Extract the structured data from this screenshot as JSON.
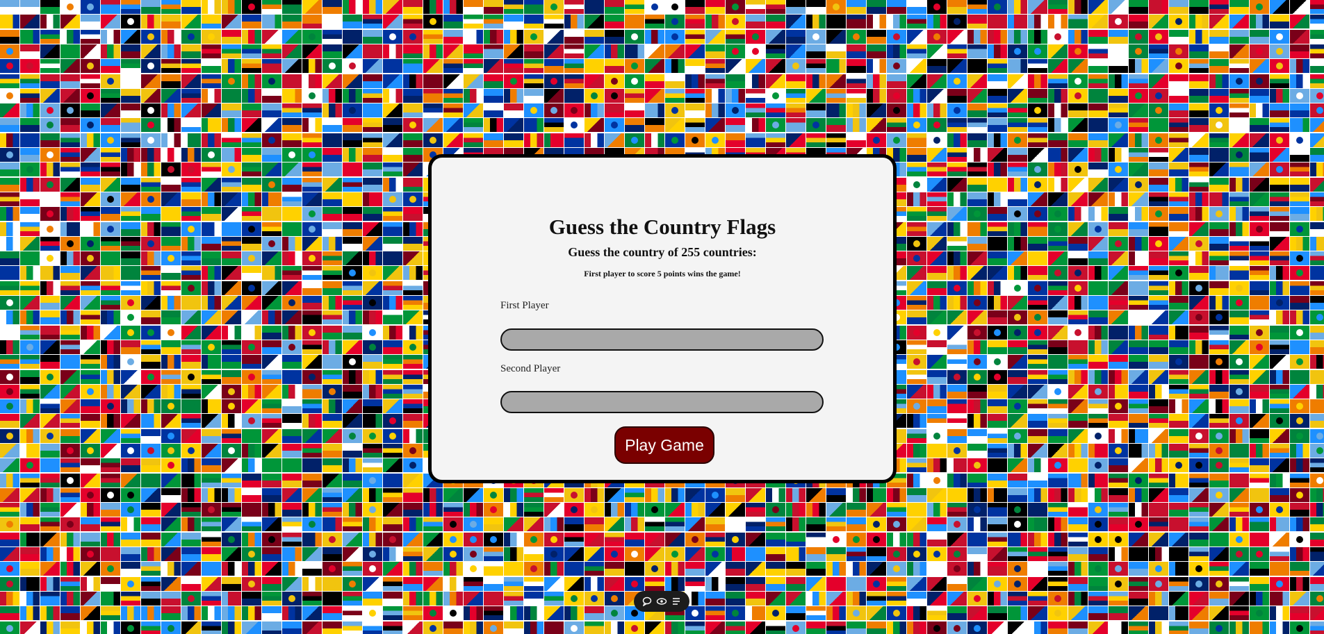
{
  "game": {
    "title": "Guess the Country Flags",
    "subtitle": "Guess the country of 255 countries:",
    "rule": "First player to score 5 points wins the game!"
  },
  "form": {
    "first_player_label": "First Player",
    "first_player_value": "",
    "second_player_label": "Second Player",
    "second_player_value": "",
    "play_button_label": "Play Game"
  },
  "background": {
    "icon": "flags-mosaic"
  },
  "toolbar": {
    "icons": [
      "comment-icon",
      "eye-icon",
      "menu-icon"
    ]
  },
  "colors": {
    "card_background": "#f4f4f4",
    "input_background": "#a9a9a9",
    "button_background": "#7a0000",
    "button_text": "#ffffff"
  }
}
